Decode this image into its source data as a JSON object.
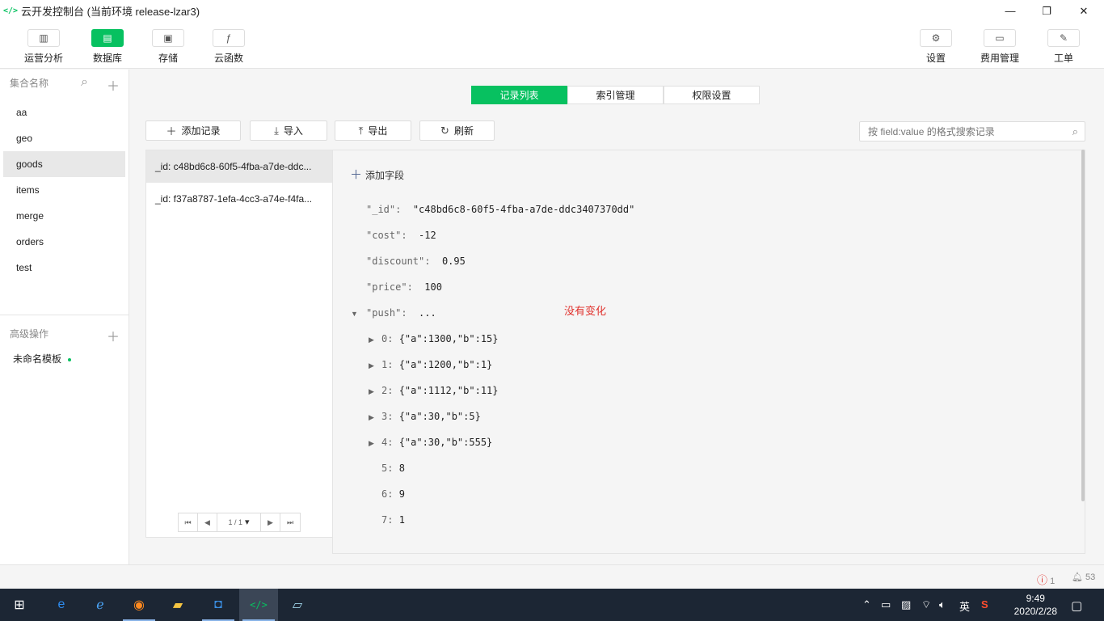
{
  "window": {
    "title": "云开发控制台 (当前环境 release-lzar3)",
    "app_icon": "code-icon"
  },
  "toolbar": {
    "left": [
      {
        "label": "运营分析",
        "icon": "bar-chart-icon"
      },
      {
        "label": "数据库",
        "icon": "database-icon",
        "active": true
      },
      {
        "label": "存储",
        "icon": "save-icon"
      },
      {
        "label": "云函数",
        "icon": "function-icon"
      }
    ],
    "right": [
      {
        "label": "设置",
        "icon": "gear-icon"
      },
      {
        "label": "费用管理",
        "icon": "billing-icon"
      },
      {
        "label": "工单",
        "icon": "ticket-icon"
      }
    ]
  },
  "sidebar": {
    "collections_header": "集合名称",
    "collections": [
      "aa",
      "geo",
      "goods",
      "items",
      "merge",
      "orders",
      "test"
    ],
    "selected": "goods",
    "advanced_header": "高级操作",
    "template": "未命名模板"
  },
  "tabs": [
    "记录列表",
    "索引管理",
    "权限设置"
  ],
  "actions": {
    "add": "添加记录",
    "import": "导入",
    "export": "导出",
    "refresh": "刷新"
  },
  "search": {
    "placeholder": "按 field:value 的格式搜索记录"
  },
  "records": [
    "_id: c48bd6c8-60f5-4fba-a7de-ddc...",
    "_id: f37a8787-1efa-4cc3-a74e-f4fa..."
  ],
  "pager": {
    "page": "1 / 1"
  },
  "detail": {
    "add_field": "添加字段",
    "fields": [
      {
        "key": "\"_id\":",
        "value": "\"c48bd6c8-60f5-4fba-a7de-ddc3407370dd\""
      },
      {
        "key": "\"cost\":",
        "value": "-12"
      },
      {
        "key": "\"discount\":",
        "value": "0.95"
      },
      {
        "key": "\"price\":",
        "value": "100"
      },
      {
        "key": "\"push\":",
        "value": "..."
      }
    ],
    "push_items": [
      {
        "key": "0:",
        "value": "{\"a\":1300,\"b\":15}"
      },
      {
        "key": "1:",
        "value": "{\"a\":1200,\"b\":1}"
      },
      {
        "key": "2:",
        "value": "{\"a\":1112,\"b\":11}"
      },
      {
        "key": "3:",
        "value": "{\"a\":30,\"b\":5}"
      },
      {
        "key": "4:",
        "value": "{\"a\":30,\"b\":555}"
      },
      {
        "key": "5:",
        "value": "8"
      },
      {
        "key": "6:",
        "value": "9"
      },
      {
        "key": "7:",
        "value": "1"
      }
    ],
    "note": "没有变化"
  },
  "statusbar": {
    "errors": "1",
    "notifications": "53"
  },
  "taskbar": {
    "ime": "英",
    "time": "9:49",
    "date": "2020/2/28"
  }
}
